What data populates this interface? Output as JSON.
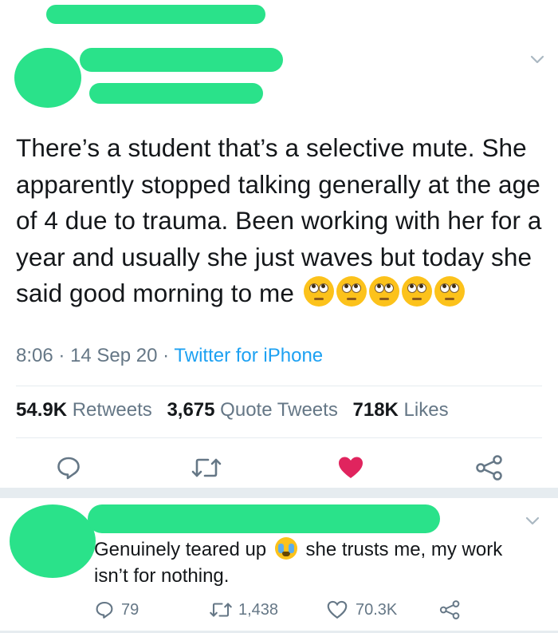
{
  "tweet": {
    "text": "There’s a student that’s a selective mute. She apparently stopped talking generally at the age of 4 due to trauma. Been working with her for a year and usually she just waves but today she said good morning to me",
    "time": "8:06",
    "date": "14 Sep 20",
    "source": "Twitter for iPhone",
    "separator": "·",
    "emoji_count": 5,
    "emoji_name": "rolling-eyes-face"
  },
  "stats": {
    "retweets_value": "54.9K",
    "retweets_label": "Retweets",
    "quotes_value": "3,675",
    "quotes_label": "Quote Tweets",
    "likes_value": "718K",
    "likes_label": "Likes"
  },
  "actions": {
    "reply_icon": "reply-icon",
    "retweet_icon": "retweet-icon",
    "like_icon": "heart-filled-icon",
    "share_icon": "share-icon",
    "like_color": "#e0245e"
  },
  "reply": {
    "text_before": "Genuinely teared up",
    "emoji_name": "loudly-crying-face",
    "text_after": "she trusts me, my work isn’t for nothing.",
    "replies": "79",
    "retweets": "1,438",
    "likes": "70.3K"
  },
  "colors": {
    "redaction": "#2ae28a",
    "muted_text": "#657786",
    "link": "#1da1f2"
  }
}
